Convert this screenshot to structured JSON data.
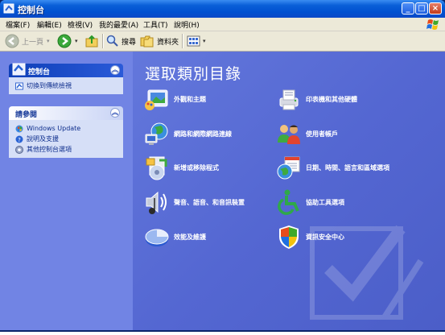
{
  "window": {
    "title": "控制台"
  },
  "menubar": {
    "items": [
      "檔案(F)",
      "編輯(E)",
      "檢視(V)",
      "我的最愛(A)",
      "工具(T)",
      "說明(H)"
    ]
  },
  "toolbar": {
    "back_label": "上一頁",
    "search_label": "搜尋",
    "folders_label": "資料夾"
  },
  "sidebar": {
    "panel1": {
      "title": "控制台",
      "links": [
        "切換到傳統檢視"
      ]
    },
    "panel2": {
      "title": "請參閱",
      "links": [
        "Windows Update",
        "說明及支援",
        "其他控制台選項"
      ]
    }
  },
  "main": {
    "heading": "選取類別目錄",
    "categories": [
      {
        "label": "外觀和主題",
        "icon": "appearance-icon"
      },
      {
        "label": "印表機和其他硬體",
        "icon": "printer-icon"
      },
      {
        "label": "網路和網際網路連線",
        "icon": "network-icon"
      },
      {
        "label": "使用者帳戶",
        "icon": "users-icon"
      },
      {
        "label": "新增或移除程式",
        "icon": "add-remove-icon"
      },
      {
        "label": "日期、時間、語言和區域選項",
        "icon": "date-globe-icon"
      },
      {
        "label": "聲音、語音、和音訊裝置",
        "icon": "sound-icon"
      },
      {
        "label": "協助工具選項",
        "icon": "accessibility-icon"
      },
      {
        "label": "效能及維護",
        "icon": "performance-icon"
      },
      {
        "label": "資訊安全中心",
        "icon": "security-shield-icon"
      }
    ]
  },
  "colors": {
    "titlebar": "#0050d0",
    "content_bg": "#5b6fd6",
    "sidebar_bg": "#7184e4",
    "panel_body": "#d6dff7",
    "link": "#0d2d8c"
  }
}
